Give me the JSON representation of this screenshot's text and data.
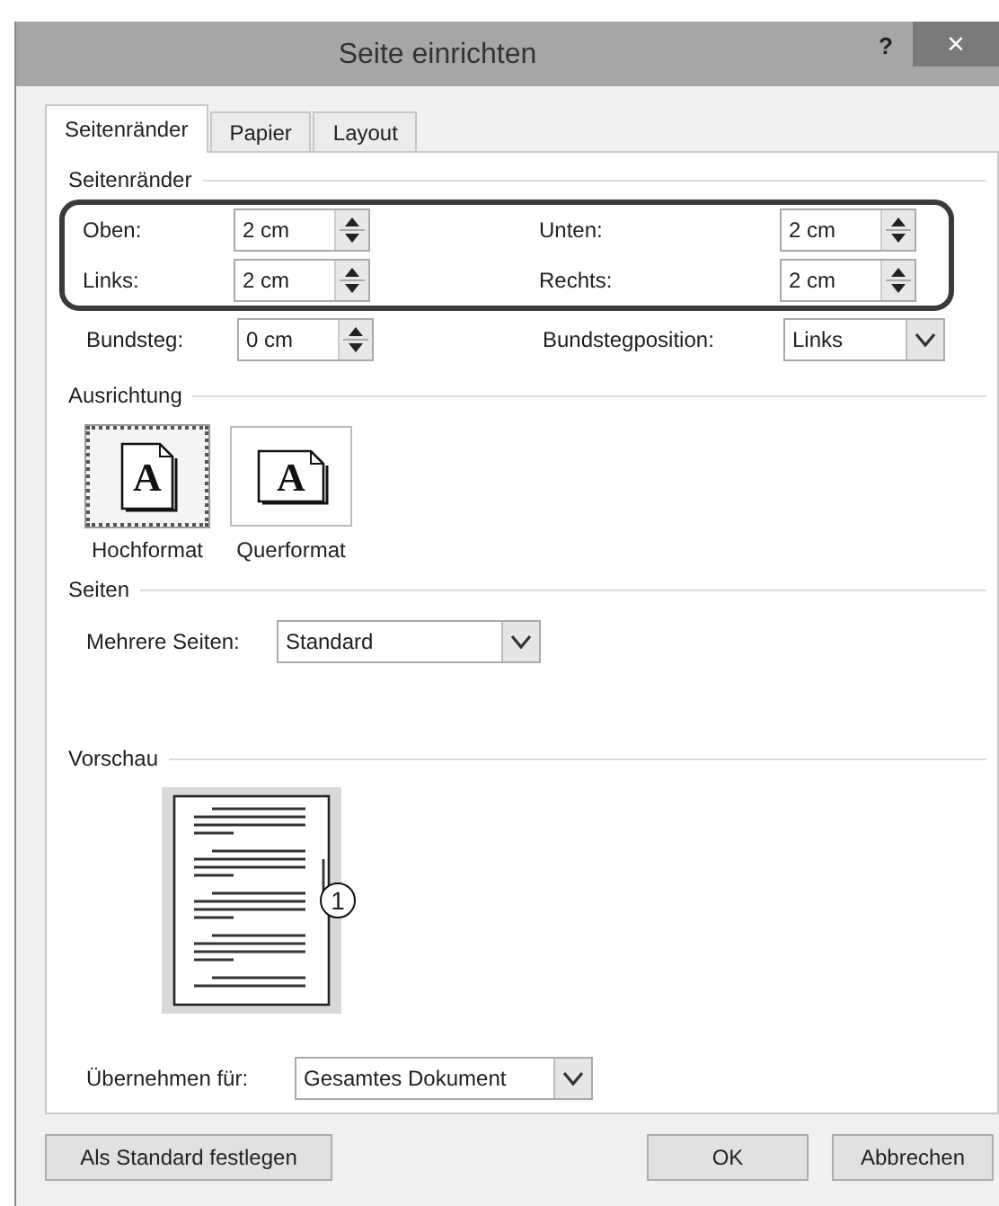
{
  "window": {
    "title": "Seite einrichten",
    "help": "?",
    "close": "×"
  },
  "tabs": [
    {
      "label": "Seitenränder",
      "selected": true
    },
    {
      "label": "Papier",
      "selected": false
    },
    {
      "label": "Layout",
      "selected": false
    }
  ],
  "margins": {
    "heading": "Seitenränder",
    "highlighted": true,
    "fields": [
      {
        "label": "Oben:",
        "value": "2 cm",
        "kind": "spin"
      },
      {
        "label": "Unten:",
        "value": "2 cm",
        "kind": "spin"
      },
      {
        "label": "Links:",
        "value": "2 cm",
        "kind": "spin"
      },
      {
        "label": "Rechts:",
        "value": "2 cm",
        "kind": "spin"
      }
    ],
    "extra": [
      {
        "label": "Bundsteg:",
        "value": "0 cm",
        "kind": "spin"
      },
      {
        "label": "Bundstegposition:",
        "value": "Links",
        "kind": "combo"
      }
    ]
  },
  "orientation": {
    "heading": "Ausrichtung",
    "options": [
      {
        "label": "Hochformat",
        "glyph": "A",
        "kind": "portrait",
        "selected": true
      },
      {
        "label": "Querformat",
        "glyph": "A",
        "kind": "landscape",
        "selected": false
      }
    ]
  },
  "pages": {
    "heading": "Seiten",
    "label": "Mehrere Seiten:",
    "value": "Standard"
  },
  "preview": {
    "heading": "Vorschau",
    "callout": "1"
  },
  "apply": {
    "label": "Übernehmen für:",
    "value": "Gesamtes Dokument"
  },
  "buttons": [
    {
      "label": "Als Standard festlegen",
      "kind": "left"
    },
    {
      "label": "OK",
      "kind": "right"
    },
    {
      "label": "Abbrechen",
      "kind": "right"
    }
  ]
}
